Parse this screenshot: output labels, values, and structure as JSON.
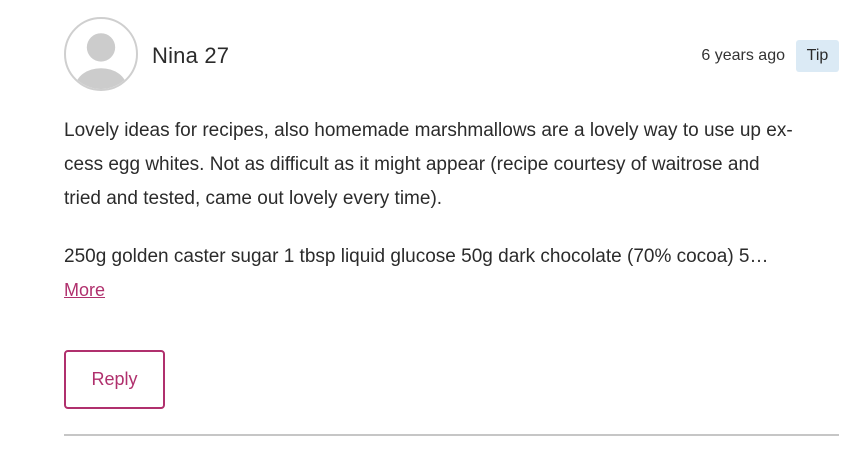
{
  "comment": {
    "author": "Nina 27",
    "timestamp": "6 years ago",
    "badge": "Tip",
    "body_lines": [
      "Lovely ideas for recipes, also homemade marshmallows are a lovely way to use up ex-",
      "cess egg whites. Not as difficult as it might appear (recipe courtesy of waitrose and",
      "tried and tested, came out lovely every time)."
    ],
    "recipe_preview": "250g golden caster sugar 1 tbsp liquid glucose 50g dark chocolate (70% cocoa) 5…",
    "more_label": "More",
    "reply_label": "Reply"
  },
  "colors": {
    "accent": "#b0306d",
    "badge_bg": "#dbeaf5",
    "divider": "#c6c6c6",
    "avatar_border": "#cfcfcf",
    "avatar_fill": "#cccccc"
  },
  "icons": {
    "avatar": "user-silhouette-icon"
  }
}
